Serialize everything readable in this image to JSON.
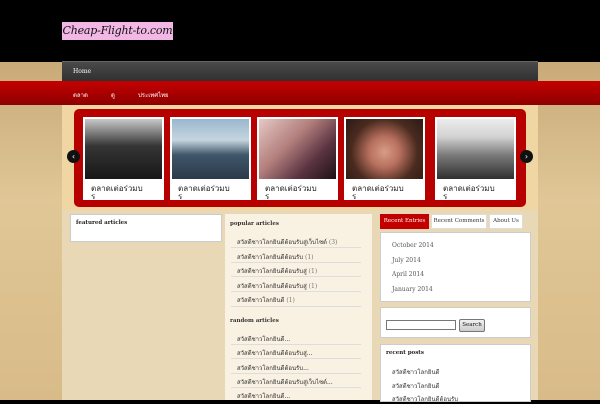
{
  "site": {
    "logo_text": "Cheap-Flight-to.com"
  },
  "nav": {
    "home": "Home"
  },
  "red_menu": [
    "ตลาด",
    "ดู",
    "ประเทศไทย"
  ],
  "slider": {
    "prev_icon": "chevron-left-icon",
    "next_icon": "chevron-right-icon",
    "slides": [
      {
        "title": "ตลาดเต่อร่วมบ",
        "title2": "ร"
      },
      {
        "title": "ตลาดเต่อร่วมบ",
        "title2": "ร"
      },
      {
        "title": "ตลาดเต่อร่วมบ",
        "title2": "ร"
      },
      {
        "title": "ตลาดเต่อร่วมบ",
        "title2": "ร"
      },
      {
        "title": "ตลาดเต่อร่วมบ",
        "title2": "ร"
      }
    ]
  },
  "featured": {
    "title": "featured articles"
  },
  "popular": {
    "title": "popular articles",
    "items": [
      {
        "text": "สวัสดีชาวโลกยินดีต้อนรับสู่เว็บไซต์",
        "count": "(3)"
      },
      {
        "text": "สวัสดีชาวโลกยินดีต้อนรับ",
        "count": "(1)"
      },
      {
        "text": "สวัสดีชาวโลกยินดีต้อนรับสู่",
        "count": "(1)"
      },
      {
        "text": "สวัสดีชาวโลกยินดีต้อนรับสู่",
        "count": "(1)"
      },
      {
        "text": "สวัสดีชาวโลกยินดี",
        "count": "(1)"
      }
    ]
  },
  "random": {
    "title": "random articles",
    "items": [
      "สวัสดีชาวโลกยินดี...",
      "สวัสดีชาวโลกยินดีต้อนรับสู่...",
      "สวัสดีชาวโลกยินดีต้อนรับ...",
      "สวัสดีชาวโลกยินดีต้อนรับสู่เว็บไซต์...",
      "สวัสดีชาวโลกยินดี..."
    ]
  },
  "tabs": [
    "Recent Entries",
    "Recent Comments",
    "About Us"
  ],
  "archives": [
    "October 2014",
    "July 2014",
    "April 2014",
    "January 2014"
  ],
  "search": {
    "button": "Search",
    "placeholder": ""
  },
  "recent_posts": {
    "title": "recent posts",
    "items": [
      "สวัสดีชาวโลกยินดี",
      "สวัสดีชาวโลกยินดี",
      "สวัสดีชาวโลกยินดีต้อนรับ"
    ]
  },
  "colors": {
    "brand_red": "#c30000",
    "header": "#000000"
  }
}
